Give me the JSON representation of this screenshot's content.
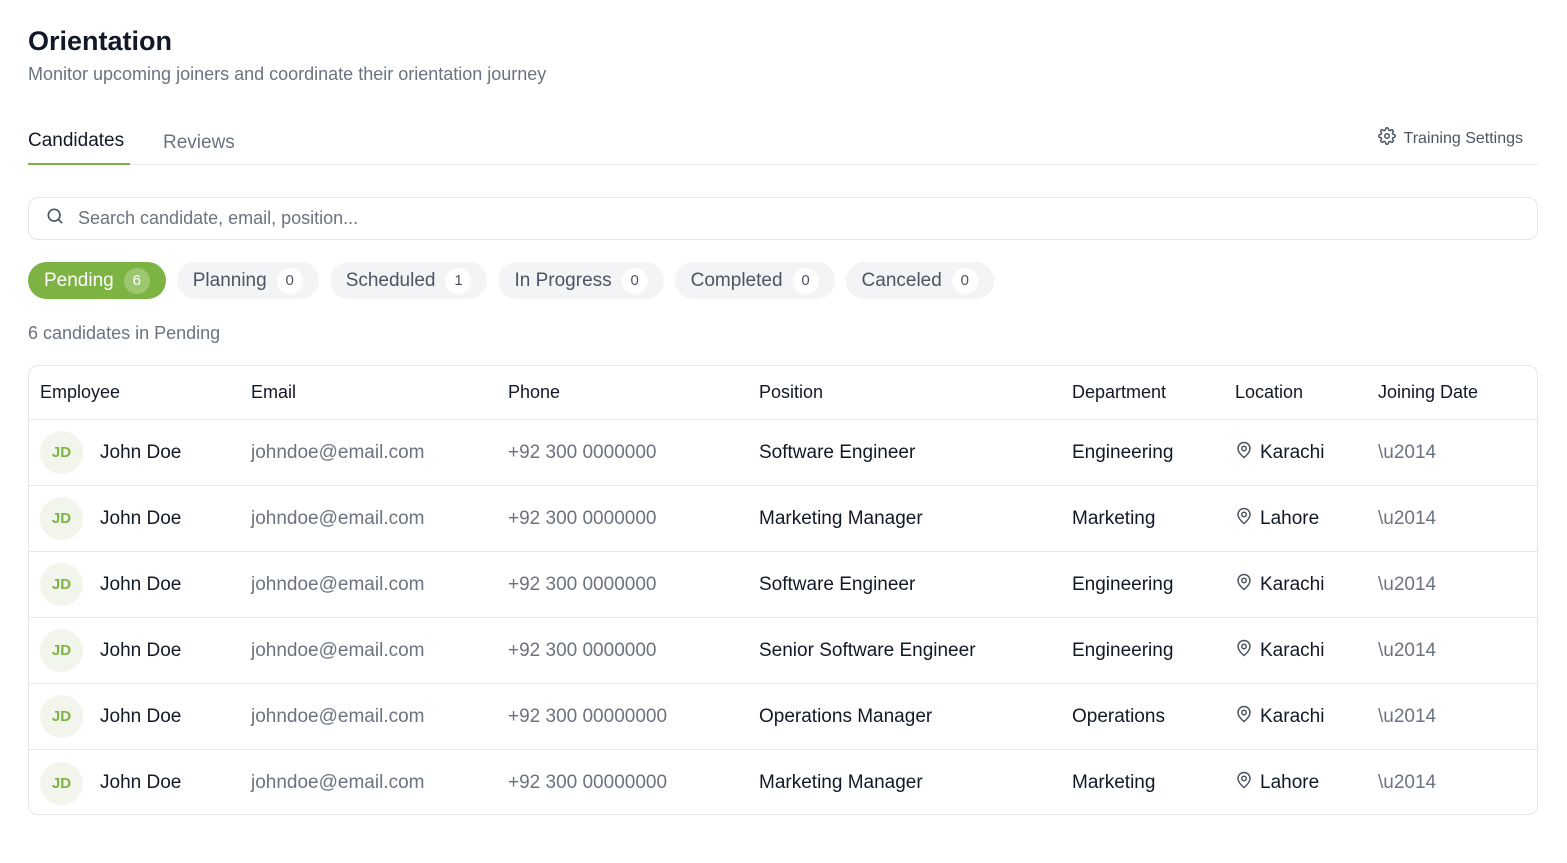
{
  "header": {
    "title": "Orientation",
    "subtitle": "Monitor upcoming joiners and coordinate their orientation journey"
  },
  "tabs": [
    {
      "label": "Candidates",
      "active": true
    },
    {
      "label": "Reviews",
      "active": false
    }
  ],
  "settings": {
    "label": "Training Settings",
    "icon": "gear-icon"
  },
  "search": {
    "placeholder": "Search candidate, email, position...",
    "value": ""
  },
  "filters": [
    {
      "label": "Pending",
      "count": "6",
      "active": true
    },
    {
      "label": "Planning",
      "count": "0",
      "active": false
    },
    {
      "label": "Scheduled",
      "count": "1",
      "active": false
    },
    {
      "label": "In Progress",
      "count": "0",
      "active": false
    },
    {
      "label": "Completed",
      "count": "0",
      "active": false
    },
    {
      "label": "Canceled",
      "count": "0",
      "active": false
    }
  ],
  "results_summary": "6 candidates in Pending",
  "table": {
    "columns": [
      "Employee",
      "Email",
      "Phone",
      "Position",
      "Department",
      "Location",
      "Joining Date"
    ],
    "rows": [
      {
        "initials": "JD",
        "name": "John Doe",
        "email": "johndoe@email.com",
        "phone": "+92 300 0000000",
        "position": "Software Engineer",
        "department": "Engineering",
        "location": "Karachi",
        "joining_date": "\\u2014"
      },
      {
        "initials": "JD",
        "name": "John Doe",
        "email": "johndoe@email.com",
        "phone": "+92 300 0000000",
        "position": "Marketing Manager",
        "department": "Marketing",
        "location": "Lahore",
        "joining_date": "\\u2014"
      },
      {
        "initials": "JD",
        "name": "John Doe",
        "email": "johndoe@email.com",
        "phone": "+92 300 0000000",
        "position": "Software Engineer",
        "department": "Engineering",
        "location": "Karachi",
        "joining_date": "\\u2014"
      },
      {
        "initials": "JD",
        "name": "John Doe",
        "email": "johndoe@email.com",
        "phone": "+92 300 0000000",
        "position": "Senior Software Engineer",
        "department": "Engineering",
        "location": "Karachi",
        "joining_date": "\\u2014"
      },
      {
        "initials": "JD",
        "name": "John Doe",
        "email": "johndoe@email.com",
        "phone": "+92 300 00000000",
        "position": "Operations Manager",
        "department": "Operations",
        "location": "Karachi",
        "joining_date": "\\u2014"
      },
      {
        "initials": "JD",
        "name": "John Doe",
        "email": "johndoe@email.com",
        "phone": "+92 300 00000000",
        "position": "Marketing Manager",
        "department": "Marketing",
        "location": "Lahore",
        "joining_date": "\\u2014"
      }
    ]
  },
  "colors": {
    "accent": "#7cb342",
    "muted_text": "#6b7280",
    "border": "#e5e7eb",
    "chip_bg": "#f3f4f6"
  }
}
